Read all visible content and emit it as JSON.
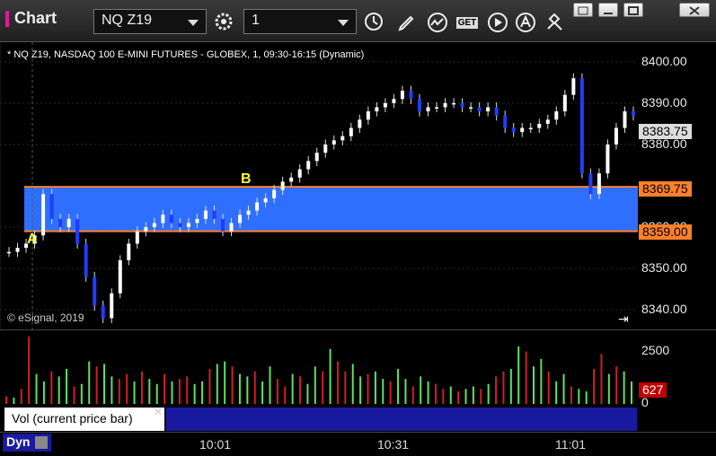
{
  "titlebar": {
    "app_title": "Chart",
    "symbol": "NQ Z19",
    "interval": "1",
    "tools": [
      "gear-icon",
      "clock-icon",
      "pen-icon",
      "line-study-icon",
      "get-icon",
      "play-icon",
      "text-annotation-icon",
      "crosshair-arrow-icon"
    ],
    "get_label": "GET"
  },
  "chart": {
    "header": "* NQ Z19, NASDAQ 100 E-MINI FUTURES - GLOBEX, 1, 09:30-16:15 (Dynamic)",
    "copyright": "© eSignal, 2019",
    "last_price": "8383.75",
    "level_upper": "8369.75",
    "level_lower": "8359.00",
    "marker_a": "A",
    "marker_b": "B",
    "colors": {
      "up": "#ffffff",
      "down": "#1f3dff",
      "band": "#2f6fff",
      "level_line": "#ff7f2a",
      "vol_up": "#60e060",
      "vol_down": "#d02020"
    }
  },
  "chart_data": {
    "type": "line",
    "series": [],
    "x": [
      "10:01",
      "10:31",
      "11:01"
    ],
    "ylim": [
      8337,
      8403
    ],
    "y_ticks": [
      "8400.00",
      "8390.00",
      "8380.00",
      "8360.00",
      "8350.00",
      "8340.00"
    ],
    "candles_close": [
      8354,
      8355,
      8356,
      8358,
      8368,
      8362,
      8360,
      8362,
      8356,
      8348,
      8341,
      8338,
      8344,
      8352,
      8356,
      8359,
      8360,
      8361,
      8363,
      8361,
      8360,
      8361,
      8362,
      8364,
      8362,
      8359,
      8361,
      8363,
      8364,
      8366,
      8367,
      8369,
      8371,
      8372,
      8374,
      8376,
      8378,
      8380,
      8381,
      8382,
      8384,
      8386,
      8388,
      8389,
      8390,
      8391,
      8393,
      8391,
      8388,
      8389,
      8389,
      8390,
      8390,
      8389,
      8389,
      8388,
      8389,
      8387,
      8384,
      8383,
      8384,
      8384,
      8385,
      8386,
      8388,
      8392,
      8396,
      8373,
      8368,
      8373,
      8380,
      8384,
      8388,
      8387
    ],
    "volume": {
      "max_label": "2500",
      "current": "627",
      "zero": "0",
      "bars": [
        300,
        250,
        600,
        2700,
        1200,
        900,
        1300,
        1100,
        1400,
        700,
        800,
        1700,
        1500,
        1600,
        1100,
        1000,
        1200,
        900,
        1300,
        1000,
        800,
        1200,
        900,
        1000,
        1100,
        800,
        900,
        1400,
        1600,
        1700,
        1500,
        1200,
        1100,
        1300,
        900,
        1500,
        1000,
        700,
        1200,
        1100,
        800,
        1500,
        1300,
        2200,
        1700,
        1300,
        1600,
        1100,
        1200,
        1300,
        1000,
        900,
        1400,
        1000,
        700,
        1100,
        900,
        800,
        600,
        700,
        500,
        600,
        700,
        600,
        800,
        1100,
        1300,
        1400,
        2300,
        2100,
        1500,
        1800,
        1300,
        900,
        1200,
        700,
        600,
        500,
        1400,
        2000,
        1200,
        1500,
        1300,
        900
      ],
      "vol_up_pattern": "mixed"
    },
    "levels": {
      "upper": 8369.75,
      "lower": 8359.0
    }
  },
  "volume_panel": {
    "label": "Vol (current price bar)",
    "close": "✕"
  },
  "bottombar": {
    "dyn_label": "Dyn",
    "time_labels": [
      "10:01",
      "10:31",
      "11:01"
    ]
  }
}
